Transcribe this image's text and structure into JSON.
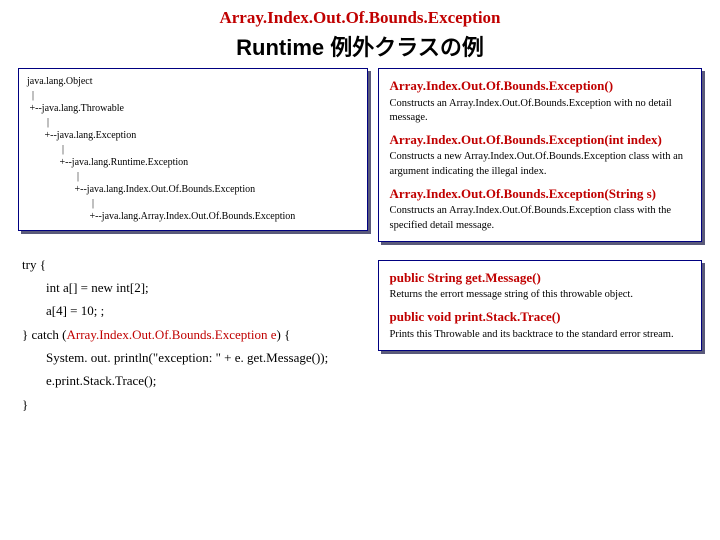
{
  "header": {
    "exception_name": "Array.Index.Out.Of.Bounds.Exception",
    "subtitle": "Runtime 例外クラスの例"
  },
  "tree": {
    "l1": "java.lang.Object",
    "l2": "  |",
    "l3": " +--java.lang.Throwable",
    "l4": "        |",
    "l5": "       +--java.lang.Exception",
    "l6": "              |",
    "l7": "             +--java.lang.Runtime.Exception",
    "l8": "                    |",
    "l9": "                   +--java.lang.Index.Out.Of.Bounds.Exception",
    "l10": "                          |",
    "l11": "                         +--java.lang.Array.Index.Out.Of.Bounds.Exception"
  },
  "api1": {
    "sig1": "Array.Index.Out.Of.Bounds.Exception()",
    "desc1": "Constructs an Array.Index.Out.Of.Bounds.Exception with no detail message.",
    "sig2": "Array.Index.Out.Of.Bounds.Exception(int  index)",
    "desc2": "Constructs a new Array.Index.Out.Of.Bounds.Exception class with an argument indicating the illegal index.",
    "sig3": "Array.Index.Out.Of.Bounds.Exception(String  s)",
    "desc3": "Constructs an Array.Index.Out.Of.Bounds.Exception class with the specified detail message."
  },
  "api2": {
    "sig1": "public String get.Message()",
    "desc1": "Returns the errort message string of this throwable object.",
    "sig2": "public void print.Stack.Trace()",
    "desc2": "Prints this Throwable and its backtrace to the standard error stream."
  },
  "code": {
    "l1": "try {",
    "l2": "int a[] = new int[2];",
    "l3": "a[4]  = 10; ;",
    "l4a": "} catch (",
    "l4b": "Array.Index.Out.Of.Bounds.Exception e",
    "l4c": ") {",
    "l5": "System. out. println(\"exception: \" + e. get.Message());",
    "l6": "e.print.Stack.Trace();",
    "l7": "}"
  }
}
